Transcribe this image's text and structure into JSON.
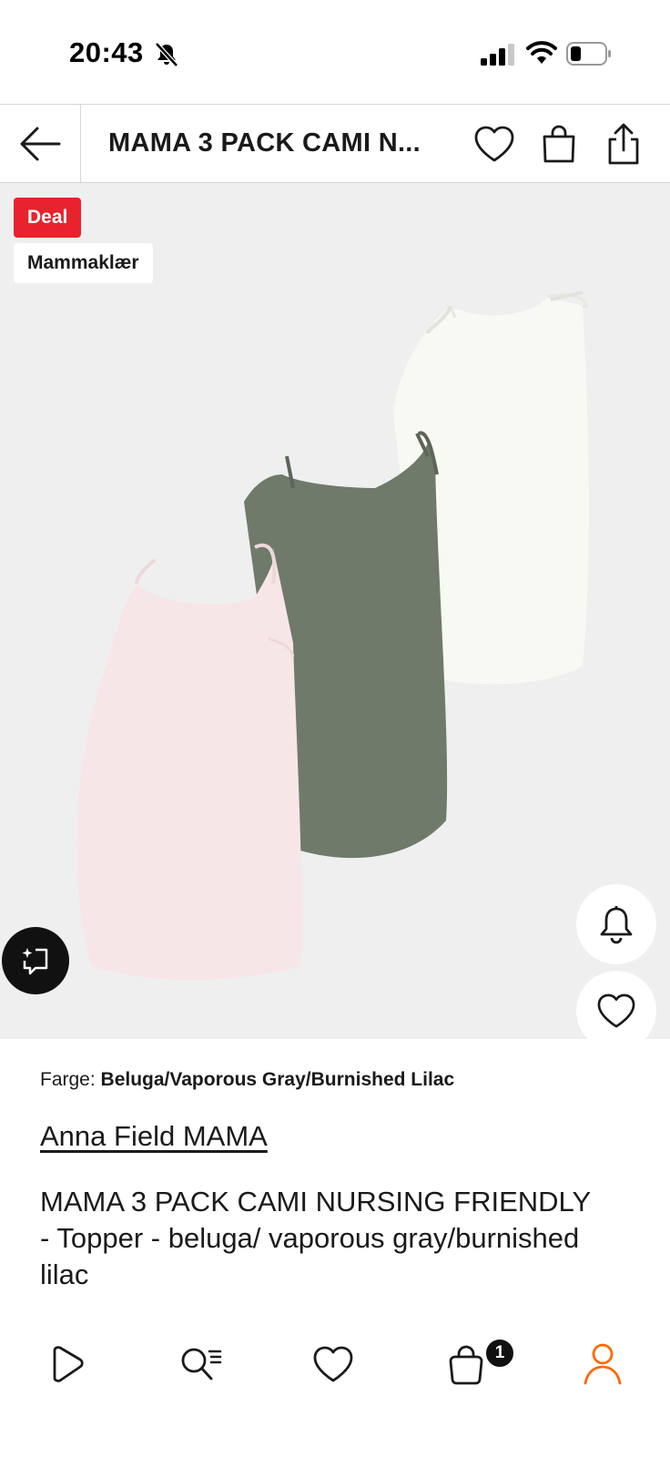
{
  "status_bar": {
    "time": "20:43"
  },
  "header": {
    "title": "MAMA 3 PACK CAMI N..."
  },
  "product_image": {
    "badges": {
      "deal": "Deal",
      "category": "Mammaklær"
    }
  },
  "details": {
    "color_label": "Farge:",
    "color_value": "Beluga/Vaporous Gray/Burnished Lilac",
    "brand": "Anna Field MAMA",
    "name": "MAMA 3 PACK CAMI NURSING FRIENDLY - Topper - beluga/ vaporous gray/burnished lilac"
  },
  "bottom_nav": {
    "cart_count": "1"
  },
  "colors": {
    "deal_red": "#e8232d",
    "accent_orange": "#ff6900",
    "image_bg": "#efeff0"
  }
}
